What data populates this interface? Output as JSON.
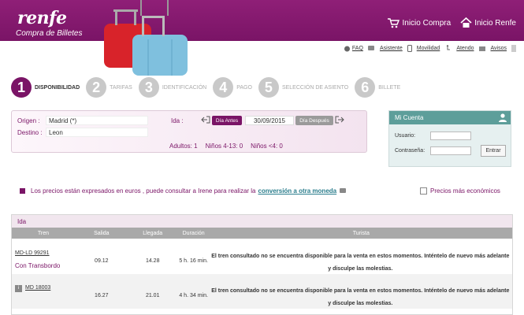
{
  "header": {
    "logo": "renfe",
    "subtitle": "Compra de Billetes",
    "links": {
      "inicio_compra": "Inicio Compra",
      "inicio_renfe": "Inicio Renfe"
    },
    "utility": {
      "faq": "FAQ",
      "asistente": "Asistente",
      "movilidad": "Movilidad",
      "atendo": "Atendo",
      "avisos": "Avisos"
    }
  },
  "steps": [
    {
      "num": "1",
      "label": "DISPONIBILIDAD"
    },
    {
      "num": "2",
      "label": "TARIFAS"
    },
    {
      "num": "3",
      "label": "IDENTIFICACIÓN"
    },
    {
      "num": "4",
      "label": "PAGO"
    },
    {
      "num": "5",
      "label": "SELECCIÓN DE ASIENTO"
    },
    {
      "num": "6",
      "label": "BILLETE"
    }
  ],
  "search": {
    "origen_label": "Origen :",
    "origen": "Madrid (*)",
    "destino_label": "Destino :",
    "destino": "Leon",
    "ida_label": "Ida :",
    "dia_antes": "Día Antes",
    "date": "30/09/2015",
    "dia_despues": "Día Después",
    "adultos": "Adultos: 1",
    "ninos": "Niños 4-13: 0",
    "ninos4": "Niños <4: 0"
  },
  "account": {
    "title": "Mi Cuenta",
    "usuario": "Usuario:",
    "contrasena": "Contraseña:",
    "entrar": "Entrar"
  },
  "notice": {
    "text": "Los precios están expresados en euros , puede consultar a Irene para realizar la",
    "link": "conversión a otra moneda",
    "cheap": "Precios más económicos"
  },
  "results": {
    "title": "Ida",
    "headers": [
      "Tren",
      "Salida",
      "Llegada",
      "Duración",
      "Turista"
    ],
    "rows": [
      {
        "code": "MD-LD 99291",
        "extra": "Con Transbordo",
        "salida": "09.12",
        "llegada": "14.28",
        "duracion": "5 h. 16 min.",
        "turista": "El tren consultado no se encuentra disponible para la venta en estos momentos. Inténtelo de nuevo más adelante y disculpe las molestias."
      },
      {
        "code": "MD 18003",
        "extra": "",
        "salida": "16.27",
        "llegada": "21.01",
        "duracion": "4 h. 34 min.",
        "turista": "El tren consultado no se encuentra disponible para la venta en estos momentos. Inténtelo de nuevo más adelante y disculpe las molestias."
      }
    ]
  },
  "colors": {
    "brand": "#7a1466",
    "teal": "#5d9e9a",
    "link": "#2a7d8c"
  }
}
